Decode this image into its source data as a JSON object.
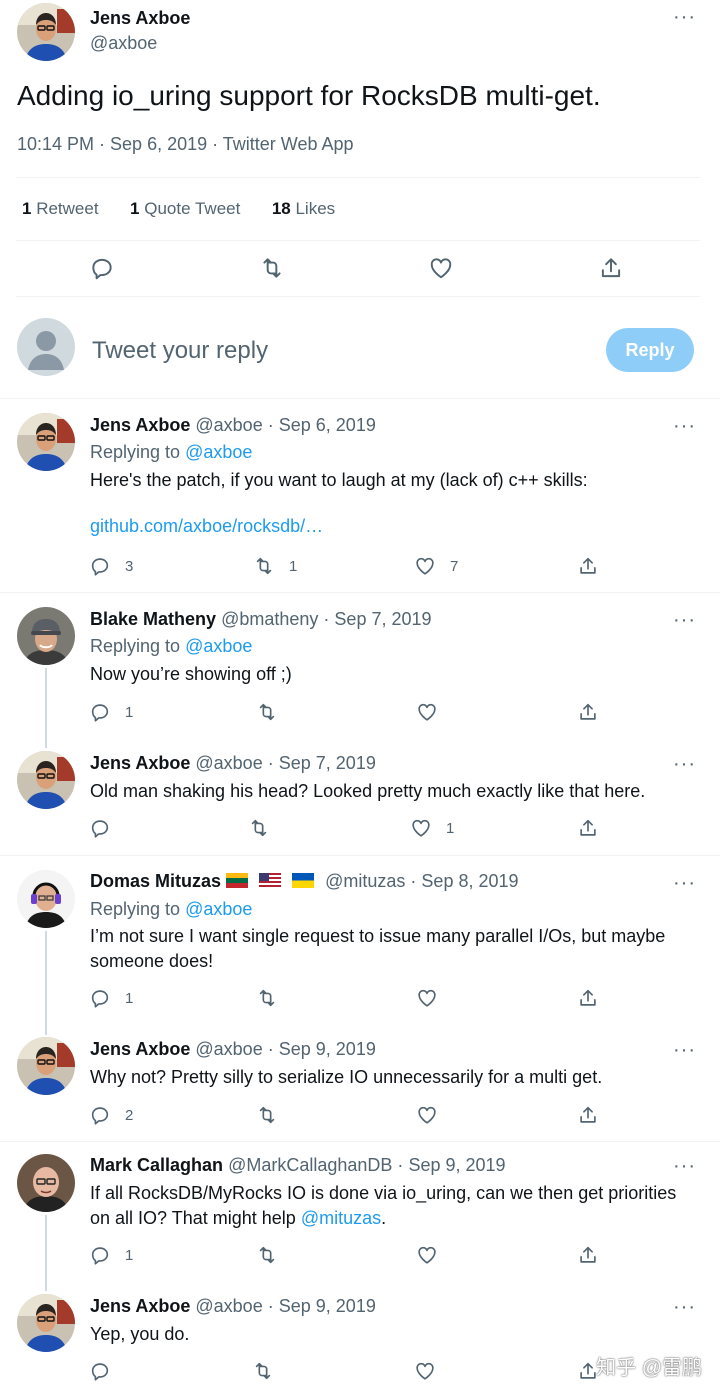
{
  "main_tweet": {
    "author_name": "Jens Axboe",
    "author_handle": "@axboe",
    "text": "Adding io_uring support for RocksDB multi-get.",
    "meta": "10:14 PM · Sep 6, 2019 · Twitter Web App",
    "stats": {
      "retweets_count": "1",
      "retweets_label": "Retweet",
      "quotes_count": "1",
      "quotes_label": "Quote Tweet",
      "likes_count": "18",
      "likes_label": "Likes"
    },
    "more": "···"
  },
  "reply_box": {
    "placeholder": "Tweet your reply",
    "button_label": "Reply"
  },
  "icons": {
    "reply": "reply-icon",
    "retweet": "retweet-icon",
    "like": "heart-icon",
    "share": "share-icon",
    "more": "more-icon"
  },
  "colors": {
    "accent": "#1d9bf0",
    "reply_button": "#8ecdf8",
    "muted": "#536471"
  },
  "replies": [
    {
      "name": "Jens Axboe",
      "handle": "@axboe",
      "date": "Sep 6, 2019",
      "replying_label": "Replying to",
      "replying_to": "@axboe",
      "text": "Here's the patch, if you want to laugh at my (lack of) c++ skills:",
      "link": "github.com/axboe/rocksdb/…",
      "reply_count": "3",
      "retweet_count": "1",
      "like_count": "7"
    },
    {
      "name": "Blake Matheny",
      "handle": "@bmatheny",
      "date": "Sep 7, 2019",
      "replying_label": "Replying to",
      "replying_to": "@axboe",
      "text": "Now you’re showing off ;)",
      "reply_count": "1",
      "retweet_count": "",
      "like_count": ""
    },
    {
      "name": "Jens Axboe",
      "handle": "@axboe",
      "date": "Sep 7, 2019",
      "text": "Old man shaking his head? Looked pretty much exactly like that here.",
      "reply_count": "",
      "retweet_count": "",
      "like_count": "1"
    },
    {
      "name": "Domas Mituzas",
      "handle": "@mituzas",
      "date": "Sep 8, 2019",
      "flags": [
        "lithuania-flag",
        "usa-flag",
        "ukraine-flag"
      ],
      "replying_label": "Replying to",
      "replying_to": "@axboe",
      "text_line1": "I’m not sure I want single request to issue many parallel I/Os, but maybe",
      "text_line2": "someone does!",
      "reply_count": "1",
      "retweet_count": "",
      "like_count": ""
    },
    {
      "name": "Jens Axboe",
      "handle": "@axboe",
      "date": "Sep 9, 2019",
      "text": "Why not? Pretty silly to serialize IO unnecessarily for a multi get.",
      "reply_count": "2",
      "retweet_count": "",
      "like_count": ""
    },
    {
      "name": "Mark Callaghan",
      "handle": "@MarkCallaghanDB",
      "date": "Sep 9, 2019",
      "text_line1": "If all RocksDB/MyRocks IO is done via io_uring, can we then get priorities",
      "text_line2": "on all IO? That might help",
      "mention": "@mituzas",
      "text_end": ".",
      "reply_count": "1",
      "retweet_count": "",
      "like_count": ""
    },
    {
      "name": "Jens Axboe",
      "handle": "@axboe",
      "date": "Sep 9, 2019",
      "text": "Yep, you do.",
      "reply_count": "",
      "retweet_count": "",
      "like_count": ""
    }
  ],
  "dot_separator": "·",
  "watermark": "知乎 @雷鹏"
}
